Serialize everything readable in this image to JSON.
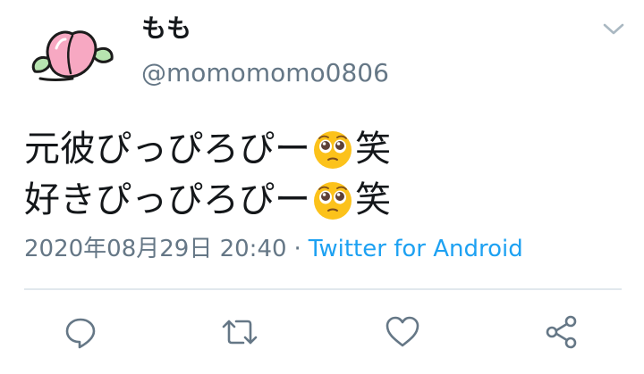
{
  "user": {
    "display_name": "もも",
    "handle": "@momomomo0806",
    "avatar_icon": "peach-avatar"
  },
  "tweet": {
    "lines": [
      {
        "before": "元彼ぴっぴろぴー",
        "emoji": "pleading-face-emoji",
        "after": "笑"
      },
      {
        "before": "好きぴっぴろぴー",
        "emoji": "pleading-face-emoji",
        "after": "笑"
      }
    ]
  },
  "meta": {
    "timestamp": "2020年08月29日 20:40",
    "separator": "·",
    "source": "Twitter for Android"
  },
  "actions": [
    {
      "icon": "reply-icon"
    },
    {
      "icon": "retweet-icon"
    },
    {
      "icon": "like-icon"
    },
    {
      "icon": "share-icon"
    }
  ],
  "colors": {
    "text": "#14171a",
    "secondary": "#657786",
    "link": "#1da1f2",
    "divider": "#e1e8ed",
    "icon": "#657786"
  }
}
